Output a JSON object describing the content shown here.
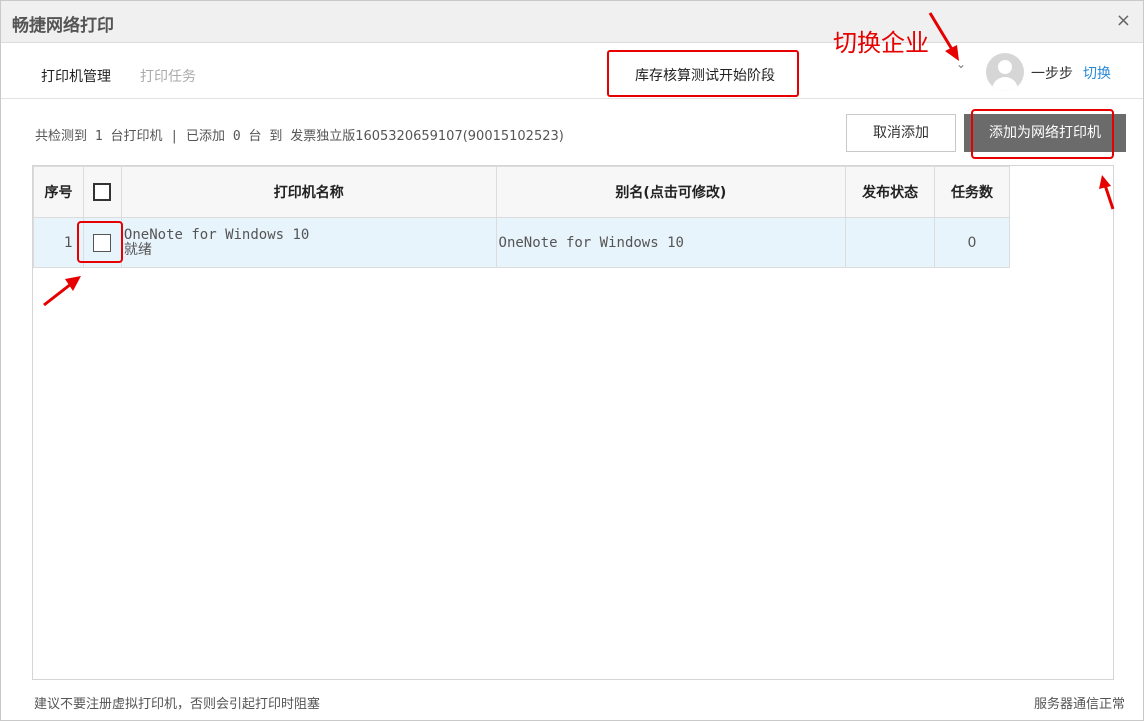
{
  "window": {
    "title": "畅捷网络打印",
    "close_glyph": "×"
  },
  "nav": {
    "tabs": [
      {
        "label": "打印机管理",
        "active": true
      },
      {
        "label": "打印任务",
        "active": false
      }
    ],
    "company_name": "库存核算测试开始阶段",
    "dropdown_glyph": "⌄",
    "username": "一步步",
    "switch_label": "切换"
  },
  "annotation": {
    "switch_company": "切换企业",
    "highlight_color": "#e60000"
  },
  "summary": {
    "detected_prefix": "共检测到",
    "detected_count": "1",
    "detected_unit": "台打印机",
    "separator": "|",
    "added_prefix": "已添加",
    "added_count": "0",
    "added_unit": "台",
    "to": "到",
    "target": "发票独立版1605320659107(90015102523)"
  },
  "actions": {
    "cancel_label": "取消添加",
    "add_label": "添加为网络打印机"
  },
  "table": {
    "columns": [
      "序号",
      "打印机名称",
      "别名(点击可修改)",
      "发布状态",
      "任务数"
    ],
    "rows": [
      {
        "seq": "1",
        "name": "OneNote for Windows 10",
        "state": "就绪",
        "alias": "OneNote for Windows 10",
        "status": "",
        "tasks": "0",
        "checked": false
      }
    ]
  },
  "footer": {
    "hint": "建议不要注册虚拟打印机，否则会引起打印时阻塞",
    "server_status": "服务器通信正常"
  }
}
